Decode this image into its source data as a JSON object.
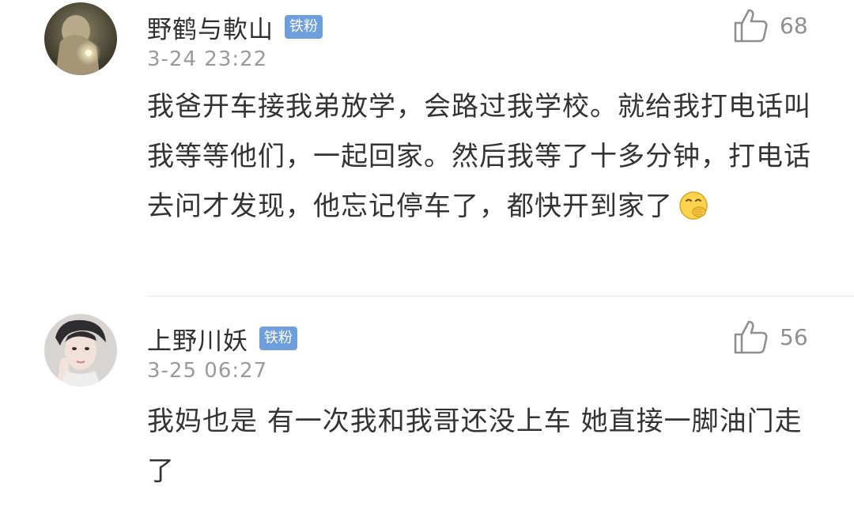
{
  "comments": [
    {
      "username": "野鹤与軟山",
      "badge": "铁粉",
      "timestamp": "3-24 23:22",
      "likes": "68",
      "text": "我爸开车接我弟放学，会路过我学校。就给我打电话叫我等等他们，一起回家。然后我等了十多分钟，打电话去问才发现，他忘记停车了，都快开到家了",
      "emoji": "face-with-hand-over-mouth-emoji"
    },
    {
      "username": "上野川妖",
      "badge": "铁粉",
      "timestamp": "3-25 06:27",
      "likes": "56",
      "text": "我妈也是 有一次我和我哥还没上车 她直接一脚油门走了"
    }
  ],
  "icons": {
    "like": "thumbs-up-outline-icon"
  },
  "colors": {
    "badge_bg": "#6e9fdc",
    "username": "#2f2f2f",
    "timestamp": "#9a9a9a",
    "text": "#333333",
    "like": "#8f8f8f"
  }
}
